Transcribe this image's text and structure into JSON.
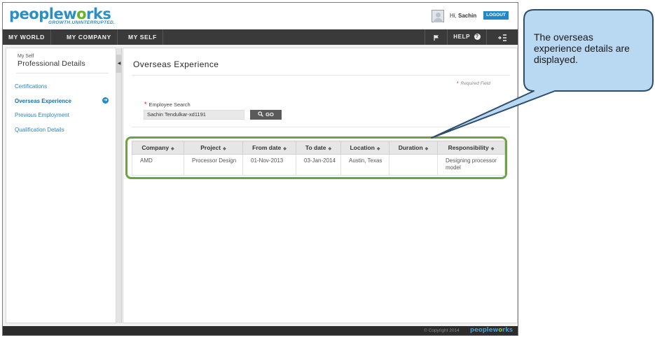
{
  "header": {
    "logo_text_a": "pe",
    "logo_text_b": "ople",
    "logo_text_c": "w",
    "logo_text_d": "o",
    "logo_text_e": "rks",
    "tagline": "GROWTH.UNINTERRUPTED.",
    "greeting_prefix": "Hi, ",
    "user_name": "Sachin",
    "logout_label": "LOGOUT"
  },
  "nav": {
    "items": [
      "MY WORLD",
      "MY COMPANY",
      "MY SELF"
    ],
    "help_label": "HELP",
    "flag_icon": "flag-icon",
    "help_icon": "question-circle-icon",
    "sidebar_toggle_icon": "sidebar-toggle-icon"
  },
  "sidebar": {
    "subtitle": "My Self",
    "title": "Professional Details",
    "items": [
      {
        "label": "Certifications",
        "active": false
      },
      {
        "label": "Overseas Experience",
        "active": true
      },
      {
        "label": "Previous Employment",
        "active": false
      },
      {
        "label": "Qualification Details",
        "active": false
      }
    ],
    "active_indicator_icon": "arrow-right-circle-icon"
  },
  "main": {
    "title": "Overseas Experience",
    "required_note": "Required Field",
    "employee_search": {
      "label": "Employee Search",
      "value": "Sachin Tendulkar-xd1191",
      "go_label": "GO",
      "search_icon": "search-icon"
    },
    "table": {
      "columns": [
        "Company",
        "Project",
        "From date",
        "To date",
        "Location",
        "Duration",
        "Responsibility"
      ],
      "rows": [
        [
          "AMD",
          "Processor Design",
          "01-Nov-2013",
          "03-Jan-2014",
          "Austin, Texas",
          "",
          "Designing processor model"
        ]
      ]
    }
  },
  "footer": {
    "copyright": "© Copyright 2014",
    "logo_a": "pe",
    "logo_b": "ople",
    "logo_c": "w",
    "logo_d": "o",
    "logo_e": "rks"
  },
  "callout": {
    "text": "The overseas experience details are displayed."
  },
  "colors": {
    "brand_blue": "#2b8fc6",
    "brand_green": "#6ab023",
    "nav_bg": "#3a3a3a",
    "highlight_green": "#6ba53f",
    "callout_fill": "#b9d8f2",
    "callout_border": "#2d4d6e"
  }
}
